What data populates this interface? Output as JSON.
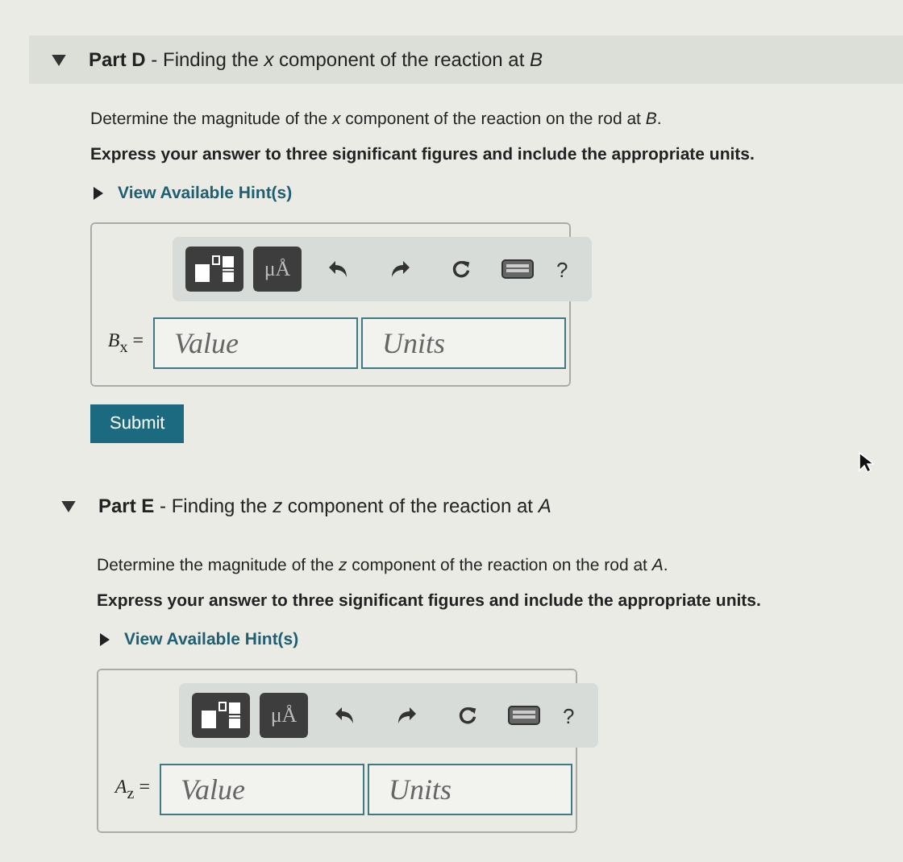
{
  "parts": [
    {
      "title": "**Part D** - Finding the *x* component of the reaction at *B*",
      "expanded": true,
      "prompt": "Determine the magnitude of the *x* component of the reaction on the rod at *B*.",
      "instruction": "Express your answer to three significant figures and include the appropriate units.",
      "hint_link": "View Available Hint(s)",
      "answer": {
        "toolbar": {
          "units_button": "μÅ",
          "help": "?"
        },
        "label": "*B*$_{x}$ =",
        "value_placeholder": "Value",
        "units_placeholder": "Units"
      },
      "submit": "Submit"
    },
    {
      "title": "**Part E** - Finding the *z* component of the reaction at *A*",
      "expanded": true,
      "prompt": "Determine the magnitude of the *z* component of the reaction on the rod at *A*.",
      "instruction": "Express your answer to three significant figures and include the appropriate units.",
      "hint_link": "View Available Hint(s)",
      "answer": {
        "toolbar": {
          "units_button": "μÅ",
          "help": "?"
        },
        "label": "*A*$_{z}$ =",
        "value_placeholder": "Value",
        "units_placeholder": "Units"
      }
    }
  ]
}
